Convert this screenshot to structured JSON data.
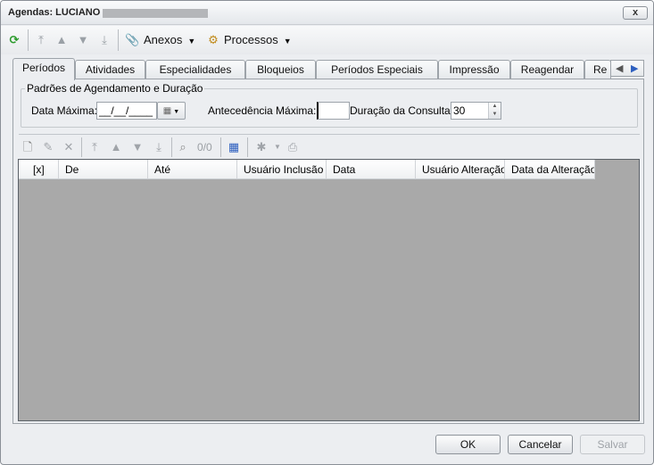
{
  "window": {
    "title": "Agendas: LUCIANO",
    "close_label": "x"
  },
  "toolbar": {
    "refresh_icon": "refresh-icon",
    "anexos_label": "Anexos",
    "processos_label": "Processos"
  },
  "tabs": [
    {
      "label": "Períodos",
      "active": true
    },
    {
      "label": "Atividades"
    },
    {
      "label": "Especialidades"
    },
    {
      "label": "Bloqueios"
    },
    {
      "label": "Períodos Especiais"
    },
    {
      "label": "Impressão"
    },
    {
      "label": "Reagendar"
    },
    {
      "label": "Re"
    }
  ],
  "group": {
    "legend": "Padrões de Agendamento e Duração",
    "data_maxima_label": "Data Máxima:",
    "data_maxima_value": "__/__/____",
    "antecedencia_label": "Antecedência  Máxima:",
    "antecedencia_value": "",
    "duracao_label": "Duração da Consulta:",
    "duracao_value": "30"
  },
  "subtoolbar": {
    "counter": "0/0"
  },
  "grid": {
    "columns": [
      "[x]",
      "De",
      "Até",
      "Usuário Inclusão",
      "Data",
      "Usuário Alteração",
      "Data da Alteração"
    ],
    "rows": []
  },
  "footer": {
    "ok_label": "OK",
    "cancel_label": "Cancelar",
    "save_label": "Salvar"
  }
}
